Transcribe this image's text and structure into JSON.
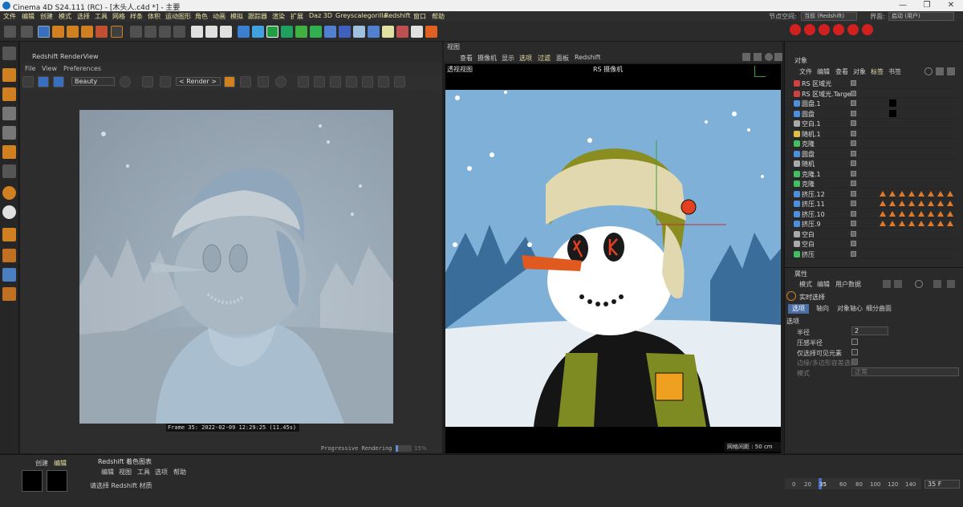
{
  "window": {
    "title": "Cinema 4D S24.111 (RC) - [木头人.c4d *] - 主要",
    "minimize": "—",
    "maximize": "❐",
    "close": "✕"
  },
  "menubar": {
    "items": [
      "文件",
      "编辑",
      "创建",
      "模式",
      "选择",
      "工具",
      "网格",
      "样条",
      "体积",
      "运动图形",
      "角色",
      "动画",
      "模拟",
      "跟踪器",
      "渲染",
      "扩展",
      "Daz 3D",
      "Greyscalegorilla",
      "Redshift",
      "窗口",
      "帮助"
    ],
    "node_space_label": "节点空间:",
    "node_space_value": "当前 (Redshift)",
    "layout_label": "界面:",
    "layout_value": "启动 (用户)"
  },
  "renderview": {
    "title": "Redshift RenderView",
    "menu": [
      "File",
      "View",
      "Preferences"
    ],
    "aov": "Beauty",
    "camera": "< Render >",
    "caption": "Frame  35:  2022-02-09  12:29:25  (11.45s)",
    "progress_text": "Progressive Rendering ..",
    "progress_fraction": 0.15,
    "progress_pct": "15%"
  },
  "viewport": {
    "panel_title": "视图",
    "menu": [
      "查看",
      "摄像机",
      "显示",
      "选项",
      "过滤",
      "面板",
      "Redshift"
    ],
    "label": "透视视图",
    "camera": "RS 摄像机",
    "grid_spacing": "网格间距 : 50 cm"
  },
  "objects": {
    "panel_title": "对象",
    "tabs": [
      "文件",
      "编辑",
      "查看",
      "对象",
      "标签",
      "书签"
    ],
    "rows": [
      {
        "name": "RS 区域光",
        "color": "#d04040"
      },
      {
        "name": "RS 区域光.Target",
        "color": "#d04040"
      },
      {
        "name": "圆盘.1",
        "color": "#4a90e0"
      },
      {
        "name": "圆盘",
        "color": "#4a90e0"
      },
      {
        "name": "空白.1",
        "color": "#aaaaaa"
      },
      {
        "name": "随机.1",
        "color": "#e0c040"
      },
      {
        "name": "克隆",
        "color": "#40c060"
      },
      {
        "name": "圆盘",
        "color": "#4a90e0"
      },
      {
        "name": "随机",
        "color": "#aaaaaa"
      },
      {
        "name": "克隆.1",
        "color": "#40c060"
      },
      {
        "name": "克隆",
        "color": "#40c060"
      },
      {
        "name": "挤压.12",
        "color": "#4a90e0"
      },
      {
        "name": "挤压.11",
        "color": "#4a90e0"
      },
      {
        "name": "挤压.10",
        "color": "#4a90e0"
      },
      {
        "name": "挤压.9",
        "color": "#4a90e0"
      },
      {
        "name": "空白",
        "color": "#aaaaaa"
      },
      {
        "name": "空白",
        "color": "#aaaaaa"
      },
      {
        "name": "挤压",
        "color": "#40c060"
      }
    ]
  },
  "attributes": {
    "panel_title": "属性",
    "menu": [
      "模式",
      "编辑",
      "用户数据"
    ],
    "mode": "实时选择",
    "tabs": [
      "选项",
      "轴向",
      "对象轴心",
      "细分曲面"
    ],
    "section": "选项",
    "radius_label": "半径",
    "radius_value": "2",
    "pressure_label": "压感半径",
    "visible_only_label": "仅选择可见元素",
    "edge_label": "边缘/多边形容差选择",
    "mode_label": "模式",
    "mode_value": "正常"
  },
  "materials": {
    "menu": [
      "创建",
      "编辑"
    ]
  },
  "shader_graph": {
    "title": "Redshift 着色图表",
    "menu": [
      "编辑",
      "视图",
      "工具",
      "选项",
      "帮助"
    ],
    "hint": "请选择 Redshift 材质"
  },
  "timeline": {
    "ticks": [
      "0",
      "20",
      "35",
      "60",
      "80",
      "100",
      "120",
      "140"
    ],
    "current_frame": "35 F"
  }
}
